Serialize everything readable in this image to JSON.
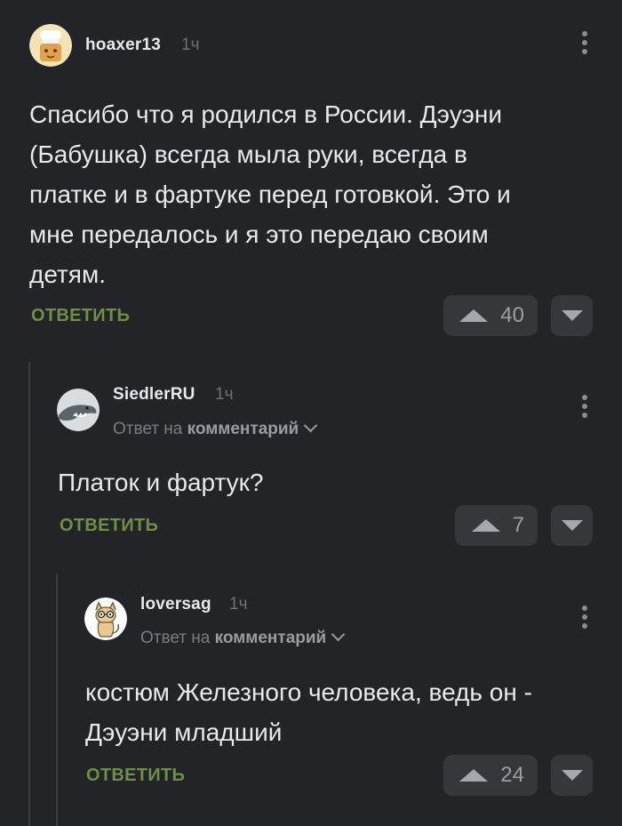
{
  "colors": {
    "background": "#232427",
    "reply_green": "#6f8f46",
    "vote_button_bg": "#36373b",
    "thread_line": "#3a3b3f"
  },
  "comments": [
    {
      "username": "hoaxer13",
      "time": "1ч",
      "avatar_icon": "chef-hat-avatar",
      "reply_to": null,
      "text_lines": [
        "Спасибо что я родился в России. Дэуэни",
        "(Бабушка) всегда мыла руки, всегда в",
        "платке и в фартуке перед готовкой. Это и",
        "мне передалось и я это передаю своим",
        "детям."
      ],
      "reply_label": "ОТВЕТИТЬ",
      "votes": "40"
    },
    {
      "username": "SiedlerRU",
      "time": "1ч",
      "avatar_icon": "shark-avatar",
      "reply_to": {
        "prefix": "Ответ на",
        "target": "комментарий"
      },
      "text_lines": [
        "Платок и фартук?"
      ],
      "reply_label": "ОТВЕТИТЬ",
      "votes": "7"
    },
    {
      "username": "loversag",
      "time": "1ч",
      "avatar_icon": "cat-with-glasses-avatar",
      "reply_to": {
        "prefix": "Ответ на",
        "target": "комментарий"
      },
      "text_lines": [
        "костюм Железного человека, ведь он -",
        "Дэуэни младший"
      ],
      "reply_label": "ОТВЕТИТЬ",
      "votes": "24"
    }
  ]
}
